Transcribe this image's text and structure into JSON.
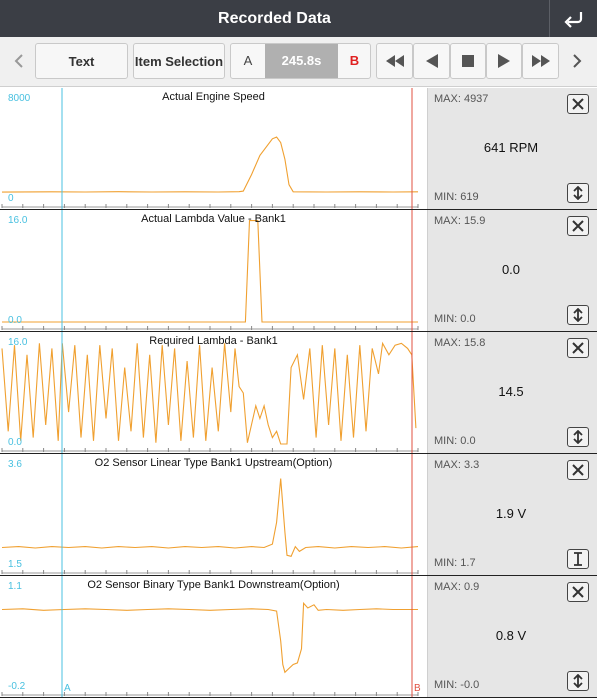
{
  "header": {
    "title": "Recorded Data"
  },
  "toolbar": {
    "text_label": "Text",
    "item_selection_label": "Item Selection",
    "marker_a": "A",
    "time": "245.8s",
    "marker_b": "B"
  },
  "icons": {
    "back": "return-arrow-icon",
    "prev_page": "chevron-left-icon",
    "next_page": "chevron-right-icon",
    "fast_rewind": "fast-rewind-icon",
    "step_back": "play-reverse-icon",
    "stop": "stop-icon",
    "play": "play-icon",
    "fast_forward": "fast-forward-icon",
    "close": "close-icon",
    "scale": "vertical-scale-icon"
  },
  "colors": {
    "trace": "#f0a030",
    "marker_a": "#48c0e0",
    "marker_b": "#e05040",
    "axis_label": "#48c0e0",
    "side_panel": "#e6e6e6",
    "titlebar": "#3b3e45"
  },
  "marker_labels": {
    "a": "A",
    "b": "B"
  },
  "chart_data": [
    {
      "type": "line",
      "title": "Actual Engine Speed",
      "ylim": [
        0,
        8000
      ],
      "ymax_label": "8000",
      "ymin_label": "0",
      "unit": "RPM",
      "current": "641 RPM",
      "max_label": "MAX: 4937",
      "min_label": "MIN: 619",
      "x_range": [
        0,
        100
      ],
      "points": [
        [
          0,
          620
        ],
        [
          12,
          640
        ],
        [
          20,
          630
        ],
        [
          28,
          650
        ],
        [
          36,
          625
        ],
        [
          44,
          640
        ],
        [
          52,
          630
        ],
        [
          57,
          650
        ],
        [
          58,
          700
        ],
        [
          60,
          2000
        ],
        [
          62,
          3500
        ],
        [
          65,
          4800
        ],
        [
          66,
          4937
        ],
        [
          67,
          4500
        ],
        [
          68,
          3200
        ],
        [
          69,
          1200
        ],
        [
          70,
          640
        ],
        [
          78,
          630
        ],
        [
          86,
          640
        ],
        [
          94,
          625
        ],
        [
          100,
          641
        ]
      ],
      "button_style": "scale"
    },
    {
      "type": "line",
      "title": "Actual Lambda Value - Bank1",
      "ylim": [
        0,
        16
      ],
      "ymax_label": "16.0",
      "ymin_label": "0.0",
      "current": "0.0",
      "max_label": "MAX: 15.9",
      "min_label": "MIN: 0.0",
      "x_range": [
        0,
        100
      ],
      "points": [
        [
          0,
          0
        ],
        [
          58.5,
          0
        ],
        [
          59.5,
          15.9
        ],
        [
          61.5,
          15.9
        ],
        [
          62.5,
          0
        ],
        [
          100,
          0
        ]
      ],
      "button_style": "scale"
    },
    {
      "type": "line",
      "title": "Required Lambda - Bank1",
      "ylim": [
        0,
        16
      ],
      "ymax_label": "16.0",
      "ymin_label": "0.0",
      "current": "14.5",
      "max_label": "MAX: 15.8",
      "min_label": "MIN: 0.0",
      "x_range": [
        0,
        100
      ],
      "points": [
        [
          0,
          15
        ],
        [
          1.5,
          2
        ],
        [
          3,
          15.5
        ],
        [
          4.5,
          0.5
        ],
        [
          6,
          14
        ],
        [
          7.5,
          1
        ],
        [
          9,
          15.8
        ],
        [
          10.5,
          3
        ],
        [
          12,
          15
        ],
        [
          13.5,
          0.5
        ],
        [
          14.5,
          15.8
        ],
        [
          16,
          5
        ],
        [
          17.5,
          15.5
        ],
        [
          19,
          1
        ],
        [
          20.5,
          14
        ],
        [
          22,
          0.5
        ],
        [
          23.5,
          15.5
        ],
        [
          25,
          4
        ],
        [
          26.5,
          15
        ],
        [
          28,
          0.5
        ],
        [
          29.5,
          12
        ],
        [
          31,
          2
        ],
        [
          32.5,
          15.8
        ],
        [
          34,
          1
        ],
        [
          35.5,
          14
        ],
        [
          37,
          0.2
        ],
        [
          38.5,
          15.5
        ],
        [
          40,
          3
        ],
        [
          41.5,
          15
        ],
        [
          43,
          0.5
        ],
        [
          44.5,
          13
        ],
        [
          46,
          1
        ],
        [
          47.5,
          15.5
        ],
        [
          49,
          0.5
        ],
        [
          50.5,
          12
        ],
        [
          52,
          2
        ],
        [
          53.5,
          15.8
        ],
        [
          55,
          5
        ],
        [
          56,
          15
        ],
        [
          57,
          9
        ],
        [
          58,
          8
        ],
        [
          59,
          0.2
        ],
        [
          61,
          6
        ],
        [
          62,
          4
        ],
        [
          63,
          6
        ],
        [
          64,
          3
        ],
        [
          65,
          1
        ],
        [
          66,
          2
        ],
        [
          67,
          0
        ],
        [
          68.5,
          0
        ],
        [
          69.5,
          12
        ],
        [
          71,
          14
        ],
        [
          72.5,
          7
        ],
        [
          74,
          15
        ],
        [
          75.5,
          1
        ],
        [
          77,
          15.5
        ],
        [
          78.5,
          3
        ],
        [
          80,
          15
        ],
        [
          81.5,
          0.5
        ],
        [
          83,
          14
        ],
        [
          84.5,
          1
        ],
        [
          86,
          15.5
        ],
        [
          87.5,
          2
        ],
        [
          89,
          15
        ],
        [
          90.5,
          11
        ],
        [
          91.5,
          15.8
        ],
        [
          93,
          14
        ],
        [
          94.5,
          15.5
        ],
        [
          96,
          15.8
        ],
        [
          97.5,
          15
        ],
        [
          98.5,
          14
        ],
        [
          99.5,
          2.5
        ]
      ],
      "button_style": "scale"
    },
    {
      "type": "line",
      "title": "O2 Sensor Linear Type Bank1 Upstream(Option)",
      "ylim": [
        1.5,
        3.6
      ],
      "ymax_label": "3.6",
      "ymin_label": "1.5",
      "unit": "V",
      "current": "1.9 V",
      "max_label": "MAX: 3.3",
      "min_label": "MIN: 1.7",
      "x_range": [
        0,
        100
      ],
      "points": [
        [
          0,
          1.88
        ],
        [
          4,
          1.9
        ],
        [
          8,
          1.87
        ],
        [
          12,
          1.9
        ],
        [
          16,
          1.88
        ],
        [
          20,
          1.9
        ],
        [
          24,
          1.87
        ],
        [
          28,
          1.9
        ],
        [
          32,
          1.88
        ],
        [
          36,
          1.9
        ],
        [
          40,
          1.87
        ],
        [
          44,
          1.9
        ],
        [
          48,
          1.88
        ],
        [
          52,
          1.9
        ],
        [
          56,
          1.87
        ],
        [
          60,
          1.9
        ],
        [
          63,
          1.88
        ],
        [
          65,
          1.95
        ],
        [
          66,
          2.4
        ],
        [
          67,
          3.3
        ],
        [
          68,
          2.2
        ],
        [
          68.5,
          1.72
        ],
        [
          69.5,
          1.7
        ],
        [
          70.5,
          1.9
        ],
        [
          71.5,
          1.8
        ],
        [
          73,
          1.88
        ],
        [
          76,
          1.9
        ],
        [
          80,
          1.87
        ],
        [
          84,
          1.9
        ],
        [
          88,
          1.88
        ],
        [
          92,
          1.9
        ],
        [
          96,
          1.87
        ],
        [
          100,
          1.9
        ]
      ],
      "button_style": "fixed"
    },
    {
      "type": "line",
      "title": "O2 Sensor Binary Type Bank1 Downstream(Option)",
      "ylim": [
        -0.2,
        1.1
      ],
      "ymax_label": "1.1",
      "ymin_label": "-0.2",
      "unit": "V",
      "current": "0.8 V",
      "max_label": "MAX: 0.9",
      "min_label": "MIN: -0.0",
      "x_range": [
        0,
        100
      ],
      "points": [
        [
          0,
          0.8
        ],
        [
          5,
          0.81
        ],
        [
          10,
          0.79
        ],
        [
          15,
          0.8
        ],
        [
          20,
          0.81
        ],
        [
          25,
          0.8
        ],
        [
          30,
          0.79
        ],
        [
          35,
          0.8
        ],
        [
          40,
          0.81
        ],
        [
          45,
          0.8
        ],
        [
          50,
          0.79
        ],
        [
          55,
          0.8
        ],
        [
          60,
          0.81
        ],
        [
          64,
          0.8
        ],
        [
          66,
          0.78
        ],
        [
          67,
          0.4
        ],
        [
          67.5,
          0.1
        ],
        [
          68,
          0.0
        ],
        [
          69,
          0.05
        ],
        [
          70,
          0.1
        ],
        [
          71,
          0.12
        ],
        [
          72,
          0.3
        ],
        [
          72.5,
          0.88
        ],
        [
          73.5,
          0.82
        ],
        [
          75,
          0.86
        ],
        [
          76,
          0.79
        ],
        [
          78,
          0.8
        ],
        [
          82,
          0.79
        ],
        [
          86,
          0.8
        ],
        [
          90,
          0.81
        ],
        [
          94,
          0.8
        ],
        [
          100,
          0.8
        ]
      ],
      "button_style": "scale"
    }
  ]
}
